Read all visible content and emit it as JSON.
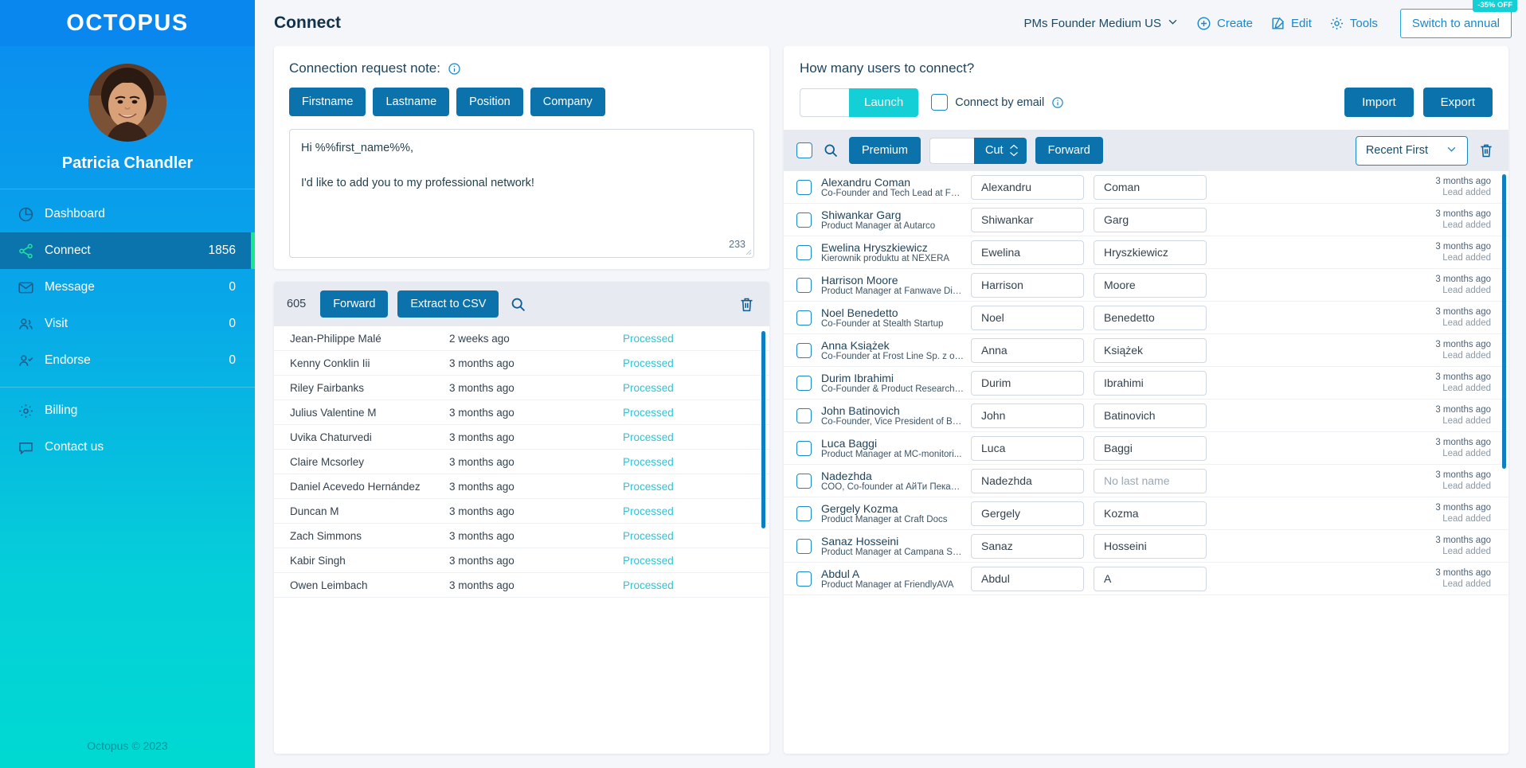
{
  "sidebar": {
    "logo": "OCTOPUS",
    "profile_name": "Patricia Chandler",
    "items": [
      {
        "label": "Dashboard",
        "count": "",
        "icon": "pie-chart-icon",
        "active": false
      },
      {
        "label": "Connect",
        "count": "1856",
        "icon": "share-nodes-icon",
        "active": true
      },
      {
        "label": "Message",
        "count": "0",
        "icon": "envelope-icon",
        "active": false
      },
      {
        "label": "Visit",
        "count": "0",
        "icon": "users-icon",
        "active": false
      },
      {
        "label": "Endorse",
        "count": "0",
        "icon": "user-check-icon",
        "active": false
      }
    ],
    "bottom_items": [
      {
        "label": "Billing",
        "icon": "gear-icon"
      },
      {
        "label": "Contact us",
        "icon": "chat-bubble-icon"
      }
    ],
    "footer": "Octopus © 2023"
  },
  "topbar": {
    "page_title": "Connect",
    "campaign": "PMs Founder Medium US",
    "create_label": "Create",
    "edit_label": "Edit",
    "tools_label": "Tools",
    "switch_annual_label": "Switch to annual",
    "discount_badge": "-35% OFF"
  },
  "note_card": {
    "heading": "Connection request note:",
    "variables": [
      "Firstname",
      "Lastname",
      "Position",
      "Company"
    ],
    "message_line1": "Hi %%first_name%%,",
    "message_line2": "I'd like to add you to my professional network!",
    "char_count": "233"
  },
  "processed_list": {
    "count": "605",
    "forward_label": "Forward",
    "extract_label": "Extract to CSV",
    "rows": [
      {
        "name": "Jean-Philippe Malé",
        "time": "2 weeks ago",
        "status": "Processed"
      },
      {
        "name": "Kenny Conklin Iii",
        "time": "3 months ago",
        "status": "Processed"
      },
      {
        "name": "Riley Fairbanks",
        "time": "3 months ago",
        "status": "Processed"
      },
      {
        "name": "Julius Valentine M",
        "time": "3 months ago",
        "status": "Processed"
      },
      {
        "name": "Uvika Chaturvedi",
        "time": "3 months ago",
        "status": "Processed"
      },
      {
        "name": "Claire Mcsorley",
        "time": "3 months ago",
        "status": "Processed"
      },
      {
        "name": "Daniel Acevedo Hernández",
        "time": "3 months ago",
        "status": "Processed"
      },
      {
        "name": "Duncan M",
        "time": "3 months ago",
        "status": "Processed"
      },
      {
        "name": "Zach Simmons",
        "time": "3 months ago",
        "status": "Processed"
      },
      {
        "name": "Kabir Singh",
        "time": "3 months ago",
        "status": "Processed"
      },
      {
        "name": "Owen Leimbach",
        "time": "3 months ago",
        "status": "Processed"
      }
    ]
  },
  "connect_panel": {
    "title": "How many users to connect?",
    "amount_value": "",
    "launch_label": "Launch",
    "connect_by_email_label": "Connect by email",
    "import_label": "Import",
    "export_label": "Export",
    "toolbar": {
      "premium_label": "Premium",
      "cut_value": "",
      "cut_label": "Cut",
      "forward_label": "Forward",
      "sort_label": "Recent First"
    },
    "rows": [
      {
        "name": "Alexandru Coman",
        "position": "Co-Founder and Tech Lead at Foo...",
        "first": "Alexandru",
        "last": "Coman",
        "last_empty": false,
        "time": "3 months ago",
        "meta": "Lead added"
      },
      {
        "name": "Shiwankar Garg",
        "position": "Product Manager at Autarco",
        "first": "Shiwankar",
        "last": "Garg",
        "last_empty": false,
        "time": "3 months ago",
        "meta": "Lead added"
      },
      {
        "name": "Ewelina Hryszkiewicz",
        "position": "Kierownik produktu at NEXERA",
        "first": "Ewelina",
        "last": "Hryszkiewicz",
        "last_empty": false,
        "time": "3 months ago",
        "meta": "Lead added"
      },
      {
        "name": "Harrison Moore",
        "position": "Product Manager at Fanwave Digi...",
        "first": "Harrison",
        "last": "Moore",
        "last_empty": false,
        "time": "3 months ago",
        "meta": "Lead added"
      },
      {
        "name": "Noel Benedetto",
        "position": "Co-Founder at Stealth Startup",
        "first": "Noel",
        "last": "Benedetto",
        "last_empty": false,
        "time": "3 months ago",
        "meta": "Lead added"
      },
      {
        "name": "Anna Książek",
        "position": "Co-Founder at Frost Line Sp. z o.o.",
        "first": "Anna",
        "last": "Książek",
        "last_empty": false,
        "time": "3 months ago",
        "meta": "Lead added"
      },
      {
        "name": "Durim Ibrahimi",
        "position": "Co-Founder & Product Researche...",
        "first": "Durim",
        "last": "Ibrahimi",
        "last_empty": false,
        "time": "3 months ago",
        "meta": "Lead added"
      },
      {
        "name": "John Batinovich",
        "position": "Co-Founder, Vice President of Bus...",
        "first": "John",
        "last": "Batinovich",
        "last_empty": false,
        "time": "3 months ago",
        "meta": "Lead added"
      },
      {
        "name": "Luca Baggi",
        "position": "Product Manager at MC-monitori...",
        "first": "Luca",
        "last": "Baggi",
        "last_empty": false,
        "time": "3 months ago",
        "meta": "Lead added"
      },
      {
        "name": "Nadezhda",
        "position": "COO, Co-founder at АйТи Пекарня",
        "first": "Nadezhda",
        "last": "No last name",
        "last_empty": true,
        "time": "3 months ago",
        "meta": "Lead added"
      },
      {
        "name": "Gergely Kozma",
        "position": "Product Manager at Craft Docs",
        "first": "Gergely",
        "last": "Kozma",
        "last_empty": false,
        "time": "3 months ago",
        "meta": "Lead added"
      },
      {
        "name": "Sanaz Hosseini",
        "position": "Product Manager at Campana Sys...",
        "first": "Sanaz",
        "last": "Hosseini",
        "last_empty": false,
        "time": "3 months ago",
        "meta": "Lead added"
      },
      {
        "name": "Abdul A",
        "position": "Product Manager at FriendlyAVA",
        "first": "Abdul",
        "last": "A",
        "last_empty": false,
        "time": "3 months ago",
        "meta": "Lead added"
      }
    ]
  },
  "colors": {
    "brand_blue": "#0b72ac",
    "accent_cyan": "#14cfd6",
    "sidebar_top": "#0a8bf0",
    "active_green": "#17e88f",
    "status_processed": "#2fc3d6"
  }
}
